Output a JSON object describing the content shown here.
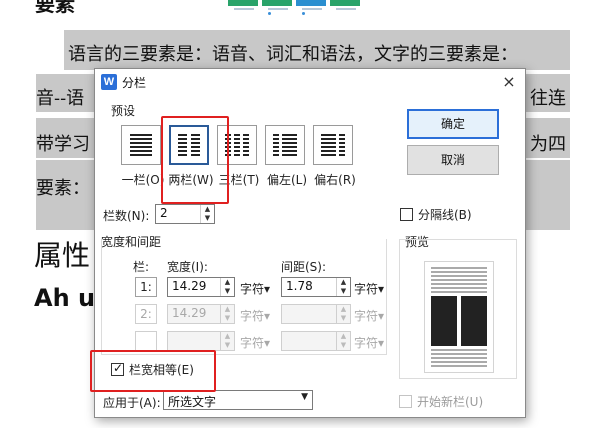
{
  "document": {
    "top_heading": "要素",
    "line1": "语言的三要素是：语音、词汇和语法，文字的三要素是：",
    "line2_left": "音--语",
    "line2_right": "往连",
    "line3_left": "带学习",
    "line3_right": "为四",
    "line4": "要素：",
    "heading_left": "属性",
    "subheading_left": "Ah u"
  },
  "dialog": {
    "title": "分栏",
    "app_icon_letter": "W",
    "close_glyph": "×",
    "preset_section_label": "预设",
    "presets": [
      {
        "label": "一栏(O)",
        "selected": false
      },
      {
        "label": "两栏(W)",
        "selected": true
      },
      {
        "label": "三栏(T)",
        "selected": false
      },
      {
        "label": "偏左(L)",
        "selected": false
      },
      {
        "label": "偏右(R)",
        "selected": false
      }
    ],
    "ok_label": "确定",
    "cancel_label": "取消",
    "num_columns_label": "栏数(N):",
    "num_columns_value": "2",
    "separator_label": "分隔线(B)",
    "separator_checked": false,
    "width_spacing_section": "宽度和间距",
    "col_header": "栏:",
    "width_header": "宽度(I):",
    "spacing_header": "间距(S):",
    "rows": [
      {
        "col": "1:",
        "width": "14.29",
        "width_unit": "字符▾",
        "spacing": "1.78",
        "spacing_unit": "字符▾",
        "enabled": true
      },
      {
        "col": "2:",
        "width": "14.29",
        "width_unit": "字符▾",
        "spacing": "",
        "spacing_unit": "字符▾",
        "enabled": false
      },
      {
        "col": "",
        "width": "",
        "width_unit": "字符▾",
        "spacing": "",
        "spacing_unit": "字符▾",
        "enabled": false
      }
    ],
    "equal_width_label": "栏宽相等(E)",
    "equal_width_checked": true,
    "preview_label": "预览",
    "apply_to_label": "应用于(A):",
    "apply_to_value": "所选文字",
    "new_column_label": "开始新栏(U)",
    "new_column_checked": false,
    "spin_up": "▲",
    "spin_down": "▼",
    "dropdown_arrow": "▼"
  },
  "colors": {
    "accent": "#2b6fd8",
    "highlight_red": "#e02020",
    "selection_gray": "#c8c8c8"
  }
}
